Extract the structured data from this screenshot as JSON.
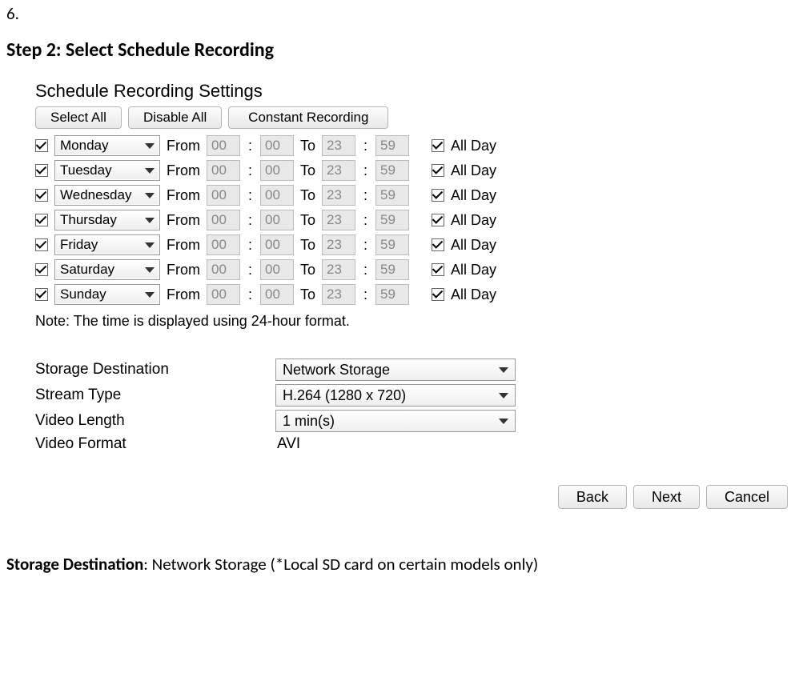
{
  "section_number": "6.",
  "step_heading": "Step 2: Select Schedule Recording",
  "panel_title": "Schedule Recording Settings",
  "buttons": {
    "select_all": "Select All",
    "disable_all": "Disable All",
    "constant_recording": "Constant Recording"
  },
  "row_labels": {
    "from": "From",
    "to": "To",
    "allday": "All Day"
  },
  "days": [
    {
      "enabled": true,
      "name": "Monday",
      "from_h": "00",
      "from_m": "00",
      "to_h": "23",
      "to_m": "59",
      "allday": true
    },
    {
      "enabled": true,
      "name": "Tuesday",
      "from_h": "00",
      "from_m": "00",
      "to_h": "23",
      "to_m": "59",
      "allday": true
    },
    {
      "enabled": true,
      "name": "Wednesday",
      "from_h": "00",
      "from_m": "00",
      "to_h": "23",
      "to_m": "59",
      "allday": true
    },
    {
      "enabled": true,
      "name": "Thursday",
      "from_h": "00",
      "from_m": "00",
      "to_h": "23",
      "to_m": "59",
      "allday": true
    },
    {
      "enabled": true,
      "name": "Friday",
      "from_h": "00",
      "from_m": "00",
      "to_h": "23",
      "to_m": "59",
      "allday": true
    },
    {
      "enabled": true,
      "name": "Saturday",
      "from_h": "00",
      "from_m": "00",
      "to_h": "23",
      "to_m": "59",
      "allday": true
    },
    {
      "enabled": true,
      "name": "Sunday",
      "from_h": "00",
      "from_m": "00",
      "to_h": "23",
      "to_m": "59",
      "allday": true
    }
  ],
  "note": "Note: The time is displayed using 24-hour format.",
  "settings": {
    "storage_destination_label": "Storage Destination",
    "storage_destination_value": "Network Storage",
    "stream_type_label": "Stream Type",
    "stream_type_value": "H.264 (1280 x 720)",
    "video_length_label": "Video Length",
    "video_length_value": "1 min(s)",
    "video_format_label": "Video Format",
    "video_format_value": "AVI"
  },
  "footer_buttons": {
    "back": "Back",
    "next": "Next",
    "cancel": "Cancel"
  },
  "storage_note_bold": "Storage Destination",
  "storage_note_rest": ": Network Storage (*Local SD card on certain models only)"
}
